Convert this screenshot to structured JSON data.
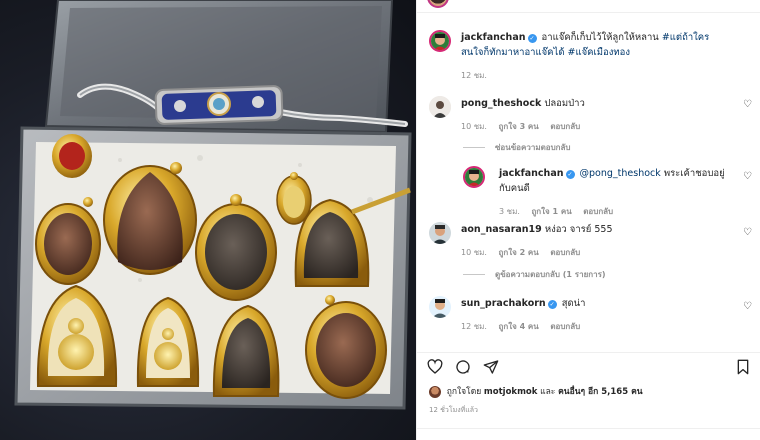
{
  "post": {
    "caption": {
      "username": "jackfanchan",
      "text": "อาแจ๊คก็เก็บไว้ให้ลูกให้หลาน",
      "hashtag_1": "#แต่ถ้าใครสนใจก็ทักมาหาอาแจ๊คได้",
      "hashtag_2": "#แจ๊คเมืองทอง",
      "time": "12 ชม."
    },
    "comments": [
      {
        "username": "pong_theshock",
        "text": "ปลอมป่าว",
        "time": "10 ชม.",
        "likes": "ถูกใจ 3 คน",
        "reply_label": "ตอบกลับ",
        "toggle": "ซ่อนข้อความตอบกลับ",
        "replies": [
          {
            "username": "jackfanchan",
            "mention": "@pong_theshock",
            "text": "พระเค้าชอบอยู่กับคนดี",
            "time": "3 ชม.",
            "likes": "ถูกใจ 1 คน",
            "reply_label": "ตอบกลับ"
          }
        ]
      },
      {
        "username": "aon_nasaran19",
        "text": "หง่อว จารย์ 555",
        "time": "10 ชม.",
        "likes": "ถูกใจ 2 คน",
        "reply_label": "ตอบกลับ",
        "toggle": "ดูข้อความตอบกลับ (1 รายการ)"
      },
      {
        "username": "sun_prachakorn",
        "text": "สุดน่า",
        "time": "12 ชม.",
        "likes": "ถูกใจ 4 คน",
        "reply_label": "ตอบกลับ"
      }
    ],
    "liked_by": {
      "prefix": "ถูกใจโดย",
      "user": "motjokmok",
      "middle": "และ",
      "others": "คนอื่นๆ อีก 5,165 คน"
    },
    "posted_ago": "12 ชั่วโมงที่แล้ว"
  },
  "icons": {
    "like": "heart-icon",
    "comment": "comment-icon",
    "share": "share-icon",
    "save": "bookmark-icon",
    "verified": "verified-badge-icon"
  },
  "colors": {
    "link": "#00376b",
    "muted": "#8e8e8e",
    "verified": "#3897f0",
    "text": "#262626"
  }
}
